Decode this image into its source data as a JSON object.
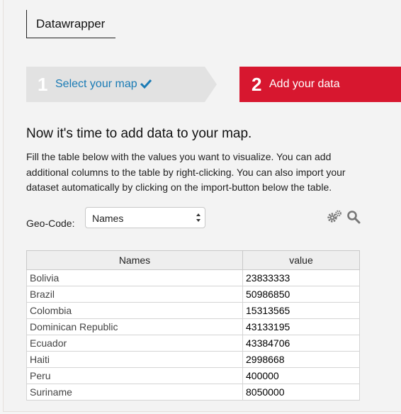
{
  "brand": "Datawrapper",
  "steps": [
    {
      "number": "1",
      "label": "Select your map",
      "status": "done"
    },
    {
      "number": "2",
      "label": "Add your data",
      "status": "active"
    }
  ],
  "heading": "Now it's time to add data to your map.",
  "intro": "Fill the table below with the values you want to visualize. You can add additional columns to the table by right-clicking. You can also import your dataset automatically by clicking on the import-button below the table.",
  "geocode": {
    "label": "Geo-Code:",
    "selected": "Names"
  },
  "tools": [
    "gear-icon",
    "search-icon"
  ],
  "colors": {
    "accent": "#d7172f",
    "link": "#1a7bb5",
    "step_done_bg": "#e2e2e2"
  },
  "table": {
    "headers": [
      "Names",
      "value"
    ],
    "rows": [
      [
        "Bolivia",
        "23833333"
      ],
      [
        "Brazil",
        "50986850"
      ],
      [
        "Colombia",
        "15313565"
      ],
      [
        "Dominican Republic",
        "43133195"
      ],
      [
        "Ecuador",
        "43384706"
      ],
      [
        "Haiti",
        "2998668"
      ],
      [
        "Peru",
        "400000"
      ],
      [
        "Suriname",
        "8050000"
      ]
    ]
  }
}
